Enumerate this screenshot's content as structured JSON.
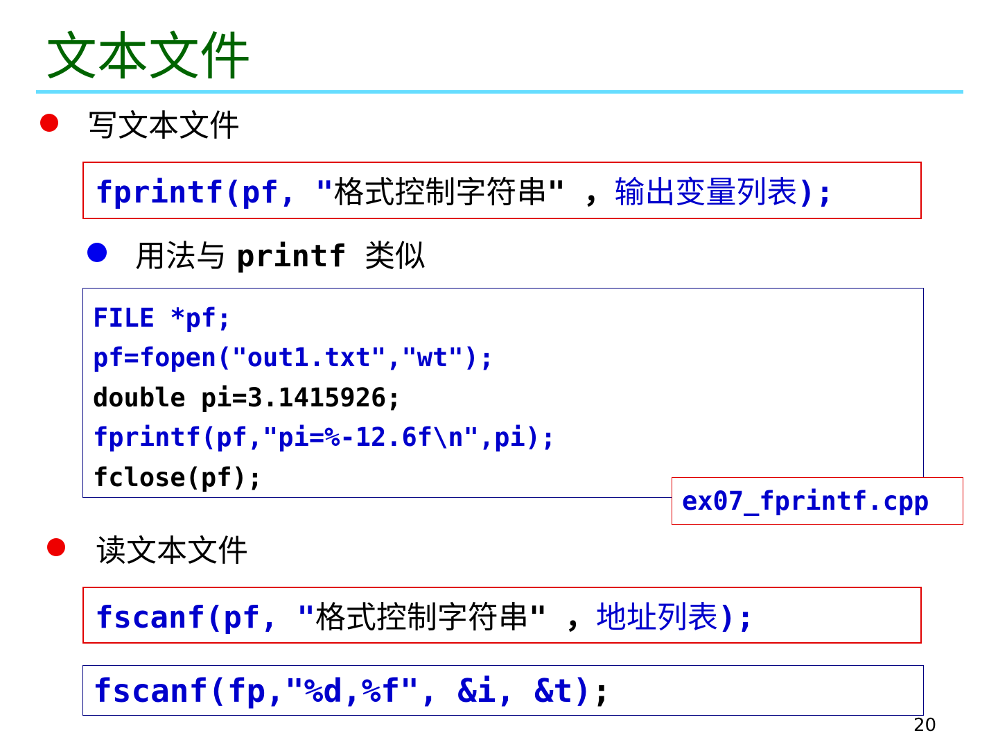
{
  "slide": {
    "title": "文本文件",
    "page_number": "20",
    "colors": {
      "title": "#006400",
      "title_rule": "#66ddff",
      "bullet_primary": "#ee0000",
      "bullet_secondary": "#0000ee",
      "code_blue": "#0000cc",
      "syntax_border": "#e00000",
      "code_border": "#000080"
    }
  },
  "write_section": {
    "heading": "写文本文件",
    "syntax": {
      "prefix": "fprintf(pf, \"",
      "format_text": "格式控制字符串",
      "middle": "\" ，",
      "args_text": "输出变量列表",
      "suffix": ");"
    },
    "sub_bullet": {
      "prefix": "用法与",
      "code": "printf",
      "suffix": "类似"
    },
    "code_lines": [
      "FILE *pf;",
      "pf=fopen(\"out1.txt\",\"wt\");",
      "double pi=3.1415926;",
      "fprintf(pf,\"pi=%-12.6f\\n\",pi);",
      "fclose(pf);"
    ],
    "file_name": "ex07_fprintf.cpp"
  },
  "read_section": {
    "heading": "读文本文件",
    "syntax": {
      "prefix": "fscanf(pf, \"",
      "format_text": "格式控制字符串",
      "middle": "\" ，",
      "args_text": "地址列表",
      "suffix": ");"
    },
    "example": {
      "code": "fscanf(fp,\"%d,%f\", &i, &t)",
      "end": ";"
    }
  }
}
